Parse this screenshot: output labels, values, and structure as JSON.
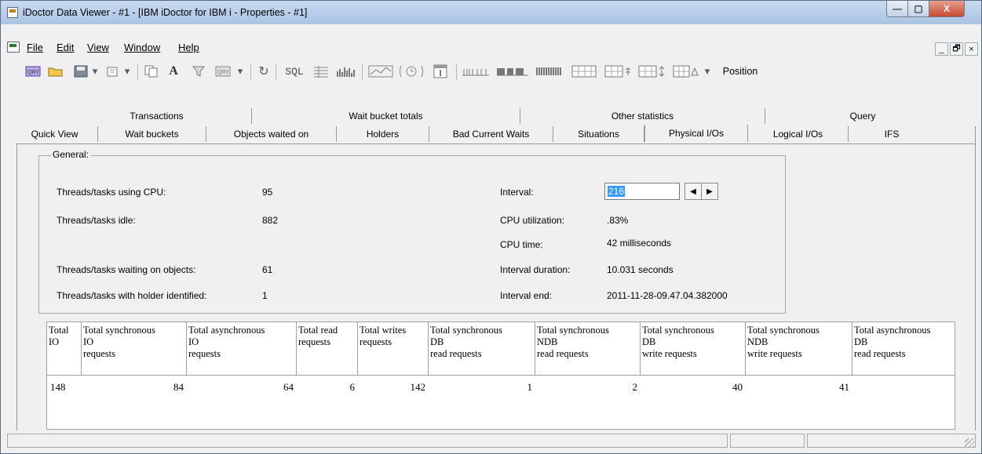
{
  "window": {
    "title": "iDoctor Data Viewer - #1 - [IBM iDoctor for IBM i - Properties - #1]",
    "min_glyph": "—",
    "max_glyph": "▢",
    "close_glyph": "X"
  },
  "menu": [
    "File",
    "Edit",
    "View",
    "Window",
    "Help"
  ],
  "mdi_buttons": [
    "_",
    "🗗",
    "×"
  ],
  "toolbar": {
    "sql_label": "SQL",
    "position_label": "Position"
  },
  "tabs": {
    "row1": [
      "Transactions",
      "Wait bucket totals",
      "Other statistics",
      "Query"
    ],
    "row2": [
      "Quick View",
      "Wait buckets",
      "Objects waited on",
      "Holders",
      "Bad Current Waits",
      "Situations",
      "Physical I/Os",
      "Logical I/Os",
      "IFS"
    ],
    "active": "Physical I/Os"
  },
  "general": {
    "title": "General:",
    "threads_cpu_label": "Threads/tasks using CPU:",
    "threads_cpu_value": "95",
    "threads_idle_label": "Threads/tasks idle:",
    "threads_idle_value": "882",
    "threads_waiting_label": "Threads/tasks waiting on objects:",
    "threads_waiting_value": "61",
    "threads_holder_label": "Threads/tasks with holder identified:",
    "threads_holder_value": "1",
    "interval_label": "Interval:",
    "interval_value": "216",
    "cpu_util_label": "CPU utilization:",
    "cpu_util_value": ".83%",
    "cpu_time_label": "CPU time:",
    "cpu_time_value": "42 milliseconds",
    "interval_duration_label": "Interval duration:",
    "interval_duration_value": "10.031 seconds",
    "interval_end_label": "Interval end:",
    "interval_end_value": "2011-11-28-09.47.04.382000"
  },
  "grid": {
    "headers": [
      [
        "Total",
        "IO",
        ""
      ],
      [
        "Total synchronous",
        "IO",
        "requests"
      ],
      [
        "Total asynchronous",
        "IO",
        "requests"
      ],
      [
        "Total read",
        "requests",
        ""
      ],
      [
        "Total writes",
        "requests",
        ""
      ],
      [
        "Total synchronous",
        "DB",
        "read requests"
      ],
      [
        "Total synchronous",
        "NDB",
        "read requests"
      ],
      [
        "Total synchronous",
        "DB",
        "write requests"
      ],
      [
        "Total synchronous",
        "NDB",
        "write requests"
      ],
      [
        "Total asynchronous",
        "DB",
        "read requests"
      ]
    ],
    "row": [
      "148",
      "84",
      "64",
      "6",
      "142",
      "1",
      "2",
      "40",
      "41",
      ""
    ]
  }
}
